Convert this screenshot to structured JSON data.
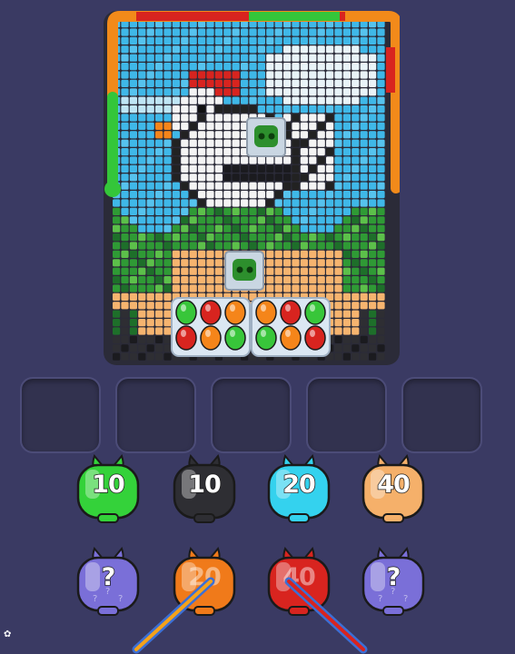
{
  "game": {
    "slots_count": 5,
    "queue_row1": [
      {
        "id": "green-pig",
        "label": "10",
        "color": "#34d23a"
      },
      {
        "id": "black-pig",
        "label": "10",
        "color": "#2e2e33"
      },
      {
        "id": "cyan-pig",
        "label": "20",
        "color": "#34d2ee"
      },
      {
        "id": "peach-pig",
        "label": "40",
        "color": "#f5b06a"
      }
    ],
    "queue_row2": [
      {
        "id": "mystery-pig-1",
        "label": "?",
        "color": "#7a6fd8"
      },
      {
        "id": "orange-pig",
        "label": "20",
        "color": "#f07a1a"
      },
      {
        "id": "red-pig",
        "label": "40",
        "color": "#d8241f"
      },
      {
        "id": "mystery-pig-2",
        "label": "?",
        "color": "#7a6fd8"
      }
    ],
    "egg_trays": [
      [
        "#38c63a",
        "#d8241f",
        "#f5851a",
        "#d8241f",
        "#f5851a",
        "#38c63a"
      ],
      [
        "#f5851a",
        "#d8241f",
        "#38c63a",
        "#38c63a",
        "#f5851a",
        "#d8241f"
      ]
    ],
    "colors": {
      "sky": "#3fb8e8",
      "cloud": "#e9f4f8",
      "chicken_white": "#f4f4f4",
      "chicken_outline": "#222222",
      "comb_red": "#d8241f",
      "beak_orange": "#f5851a",
      "grass_green": "#2f9a35",
      "ground_peach": "#f6b46f",
      "snake_green": "#34c63a",
      "snake_orange": "#f28a1a",
      "background": "#3a3a63"
    }
  }
}
